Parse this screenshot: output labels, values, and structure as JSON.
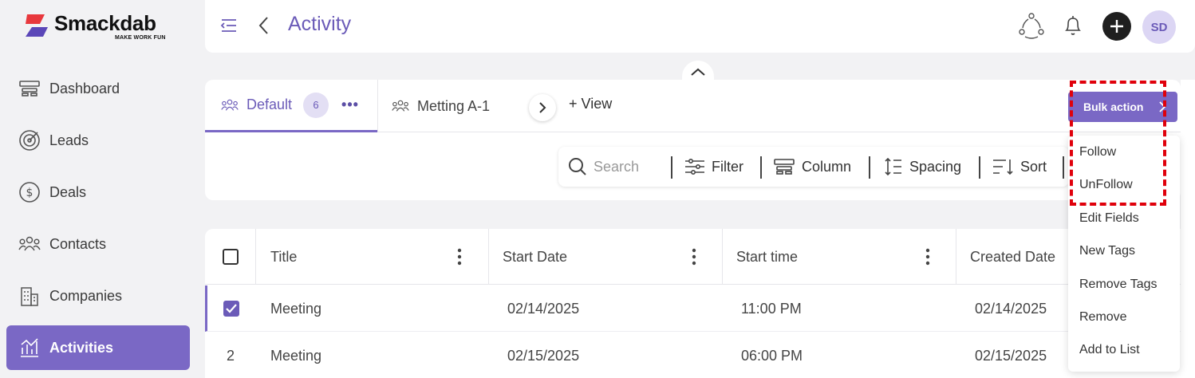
{
  "brand": {
    "name": "Smackdab",
    "tagline": "MAKE WORK FUN"
  },
  "sidebar": {
    "items": [
      {
        "label": "Dashboard",
        "icon": "dashboard-icon"
      },
      {
        "label": "Leads",
        "icon": "target-icon"
      },
      {
        "label": "Deals",
        "icon": "dollar-icon"
      },
      {
        "label": "Contacts",
        "icon": "people-icon"
      },
      {
        "label": "Companies",
        "icon": "building-icon"
      },
      {
        "label": "Activities",
        "icon": "activity-icon",
        "active": true
      }
    ]
  },
  "header": {
    "title": "Activity",
    "avatar_initials": "SD"
  },
  "tabs": [
    {
      "label": "Default",
      "count": "6",
      "active": true
    },
    {
      "label": "Metting A-1"
    }
  ],
  "add_view_label": "+ View",
  "bulk_action_label": "Bulk action",
  "toolbar": {
    "search_placeholder": "Search",
    "filter_label": "Filter",
    "column_label": "Column",
    "spacing_label": "Spacing",
    "sort_label": "Sort"
  },
  "table": {
    "columns": [
      "Title",
      "Start Date",
      "Start time",
      "Created Date"
    ],
    "rows": [
      {
        "index": "",
        "checked": true,
        "title": "Meeting",
        "start_date": "02/14/2025",
        "start_time": "11:00 PM",
        "created_date": "02/14/2025"
      },
      {
        "index": "2",
        "checked": false,
        "title": "Meeting",
        "start_date": "02/15/2025",
        "start_time": "06:00 PM",
        "created_date": "02/15/2025"
      }
    ]
  },
  "dropdown": {
    "items": [
      "Follow",
      "UnFollow",
      "Edit Fields",
      "New Tags",
      "Remove Tags",
      "Remove",
      "Add to List"
    ]
  },
  "colors": {
    "accent": "#7a68c5",
    "highlight": "#e0000b"
  }
}
